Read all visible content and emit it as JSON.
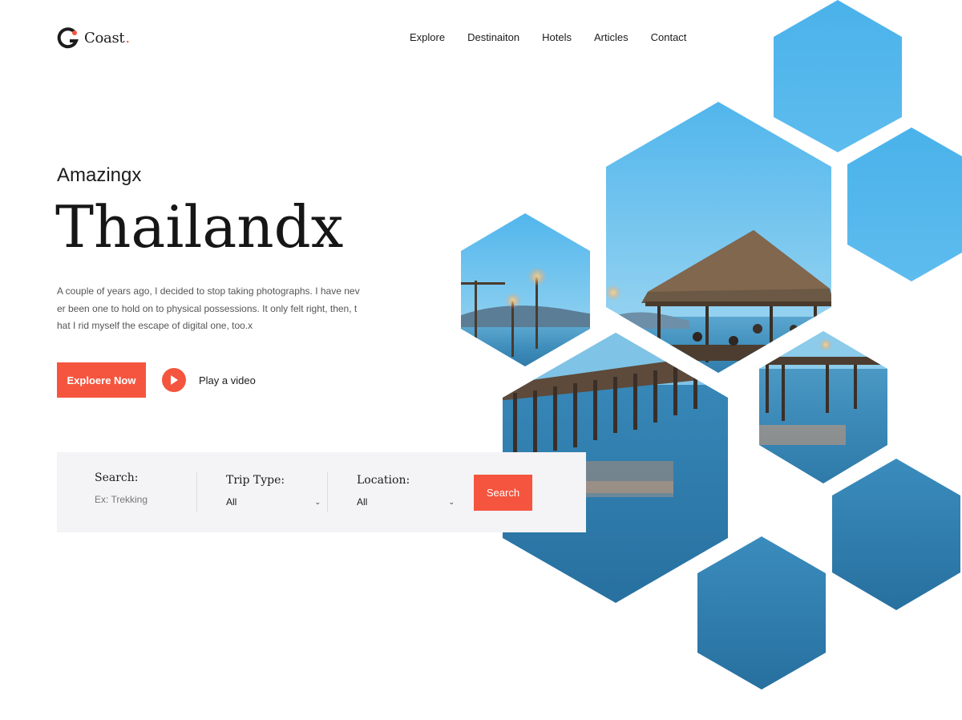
{
  "brand": {
    "name": "Coast",
    "dot": "."
  },
  "nav": {
    "items": [
      {
        "label": "Explore"
      },
      {
        "label": "Destinaiton"
      },
      {
        "label": "Hotels"
      },
      {
        "label": "Articles"
      },
      {
        "label": "Contact"
      }
    ]
  },
  "hero": {
    "kicker": "Amazingx",
    "title": "Thailandx",
    "description": "A couple of years ago, I decided to stop taking photographs. I have never been one to hold on to physical possessions. It only felt right, then, that I rid myself the escape of digital one, too.x",
    "primary_button": "Exploere Now",
    "video_label": "Play a video"
  },
  "search": {
    "search_label": "Search:",
    "search_placeholder": "Ex: Trekking",
    "trip_label": "Trip Type:",
    "trip_value": "All",
    "location_label": "Location:",
    "location_value": "All",
    "button_label": "Search"
  },
  "colors": {
    "accent": "#f5553f",
    "search_bg": "#f4f4f6",
    "sky": "#4fb3e8",
    "sea": "#2a7fb0"
  },
  "icons": {
    "logo": "coast-logo-icon",
    "play": "play-icon",
    "chevron": "chevron-down-icon"
  }
}
